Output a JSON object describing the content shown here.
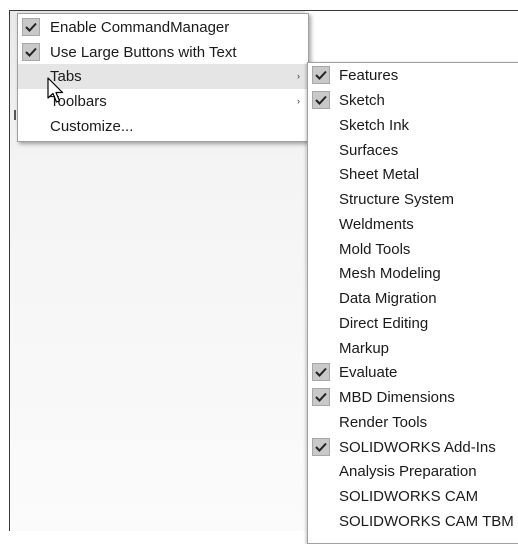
{
  "main_menu": {
    "items": [
      {
        "label": "Enable CommandManager",
        "checked": true
      },
      {
        "label": "Use Large Buttons with Text",
        "checked": true
      },
      {
        "label": "Tabs",
        "submenu": true
      },
      {
        "label": "Toolbars",
        "submenu": true
      },
      {
        "label": "Customize..."
      }
    ]
  },
  "tabs_submenu": {
    "items": [
      {
        "label": "Features",
        "checked": true
      },
      {
        "label": "Sketch",
        "checked": true
      },
      {
        "label": "Sketch Ink"
      },
      {
        "label": "Surfaces"
      },
      {
        "label": "Sheet Metal"
      },
      {
        "label": "Structure System"
      },
      {
        "label": "Weldments"
      },
      {
        "label": "Mold Tools"
      },
      {
        "label": "Mesh Modeling"
      },
      {
        "label": "Data Migration"
      },
      {
        "label": "Direct Editing"
      },
      {
        "label": "Markup"
      },
      {
        "label": "Evaluate",
        "checked": true
      },
      {
        "label": "MBD Dimensions",
        "checked": true
      },
      {
        "label": "Render Tools"
      },
      {
        "label": "SOLIDWORKS Add-Ins",
        "checked": true
      },
      {
        "label": "Analysis Preparation"
      },
      {
        "label": "SOLIDWORKS CAM"
      },
      {
        "label": "SOLIDWORKS CAM TBM"
      }
    ]
  },
  "icons": {
    "check": "checkmark-icon",
    "submenu_arrow": "submenu-arrow-icon",
    "cursor": "mouse-pointer-icon"
  }
}
